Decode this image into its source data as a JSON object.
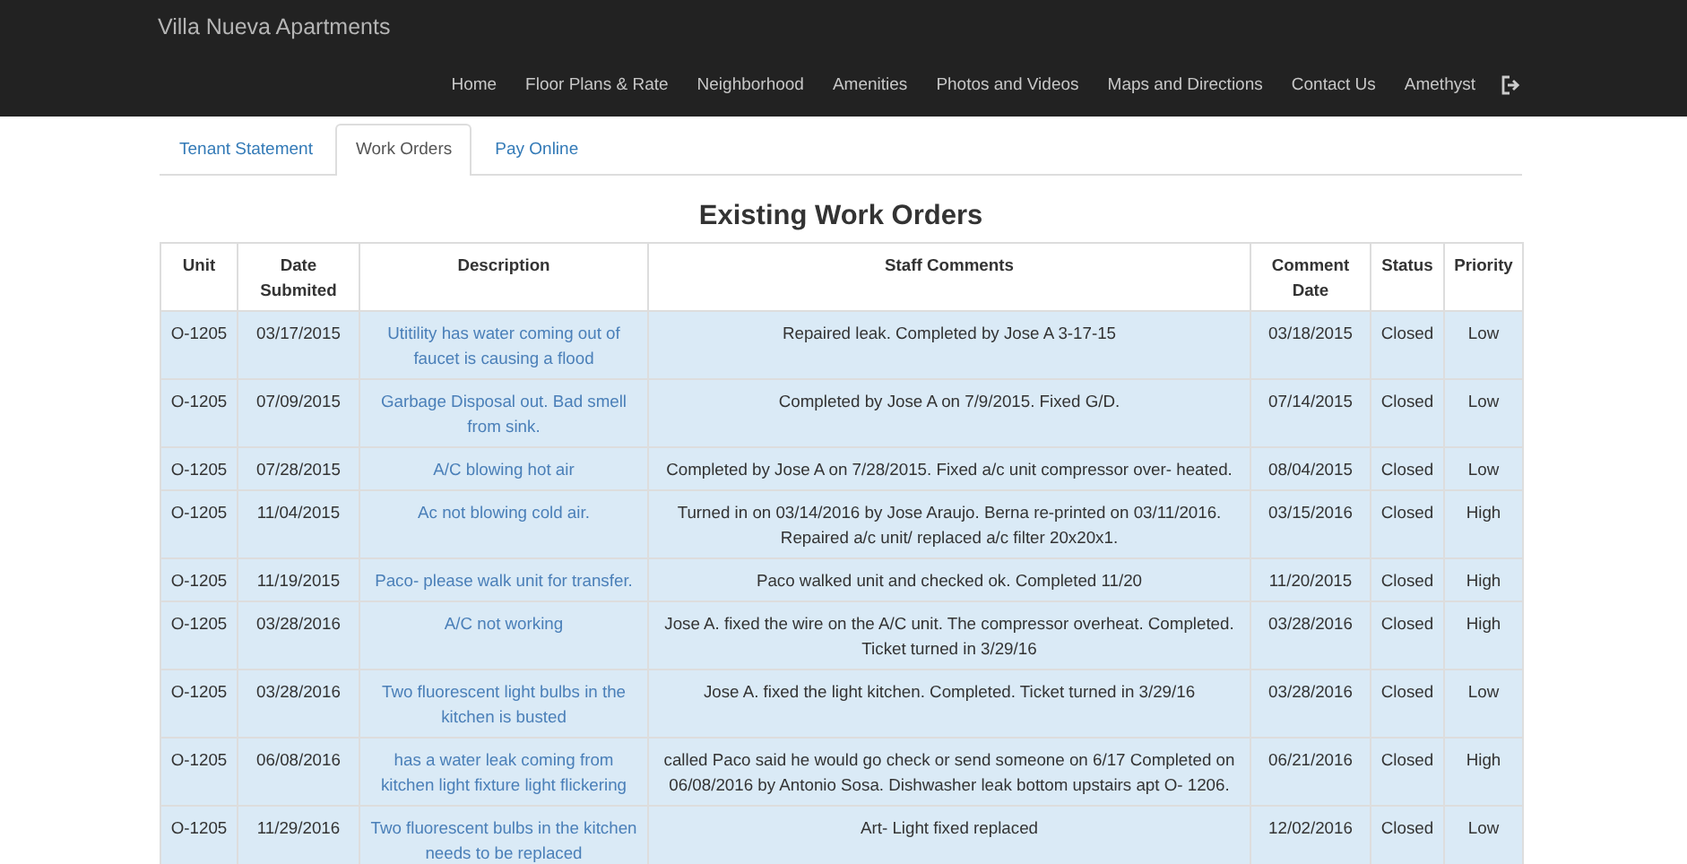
{
  "navbar": {
    "brand": "Villa Nueva Apartments",
    "links": [
      "Home",
      "Floor Plans & Rate",
      "Neighborhood",
      "Amenities",
      "Photos and Videos",
      "Maps and Directions",
      "Contact Us",
      "Amethyst"
    ]
  },
  "tabs": [
    {
      "label": "Tenant Statement",
      "selected": false
    },
    {
      "label": "Work Orders",
      "selected": true
    },
    {
      "label": "Pay Online",
      "selected": false
    }
  ],
  "heading": "Existing Work Orders",
  "table": {
    "columns": [
      "Unit",
      "Date Submited",
      "Description",
      "Staff Comments",
      "Comment Date",
      "Status",
      "Priority"
    ],
    "rows": [
      {
        "unit": "O-1205",
        "date": "03/17/2015",
        "description": "Utitility has water coming out of faucet is causing a flood",
        "comments": "Repaired leak. Completed by Jose A 3-17-15",
        "comment_date": "03/18/2015",
        "status": "Closed",
        "priority": "Low"
      },
      {
        "unit": "O-1205",
        "date": "07/09/2015",
        "description": "Garbage Disposal out. Bad smell from sink.",
        "comments": "Completed by Jose A on 7/9/2015. Fixed G/D.",
        "comment_date": "07/14/2015",
        "status": "Closed",
        "priority": "Low"
      },
      {
        "unit": "O-1205",
        "date": "07/28/2015",
        "description": "A/C blowing hot air",
        "comments": "Completed by Jose A on 7/28/2015. Fixed a/c unit compressor over- heated.",
        "comment_date": "08/04/2015",
        "status": "Closed",
        "priority": "Low"
      },
      {
        "unit": "O-1205",
        "date": "11/04/2015",
        "description": "Ac not blowing cold air.",
        "comments": "Turned in on 03/14/2016 by Jose Araujo. Berna re-printed on 03/11/2016. Repaired a/c unit/ replaced a/c filter 20x20x1.",
        "comment_date": "03/15/2016",
        "status": "Closed",
        "priority": "High"
      },
      {
        "unit": "O-1205",
        "date": "11/19/2015",
        "description": "Paco- please walk unit for transfer.",
        "comments": "Paco walked unit and checked ok. Completed 11/20",
        "comment_date": "11/20/2015",
        "status": "Closed",
        "priority": "High"
      },
      {
        "unit": "O-1205",
        "date": "03/28/2016",
        "description": "A/C not working",
        "comments": "Jose A. fixed the wire on the A/C unit. The compressor overheat. Completed. Ticket turned in 3/29/16",
        "comment_date": "03/28/2016",
        "status": "Closed",
        "priority": "High"
      },
      {
        "unit": "O-1205",
        "date": "03/28/2016",
        "description": "Two fluorescent light bulbs in the kitchen is busted",
        "comments": "Jose A. fixed the light kitchen. Completed. Ticket turned in 3/29/16",
        "comment_date": "03/28/2016",
        "status": "Closed",
        "priority": "Low"
      },
      {
        "unit": "O-1205",
        "date": "06/08/2016",
        "description": "has a water leak coming from kitchen light fixture light flickering",
        "comments": "called Paco said he would go check or send someone on 6/17 Completed on 06/08/2016 by Antonio Sosa. Dishwasher leak bottom upstairs apt O- 1206.",
        "comment_date": "06/21/2016",
        "status": "Closed",
        "priority": "High"
      },
      {
        "unit": "O-1205",
        "date": "11/29/2016",
        "description": "Two fluorescent bulbs in the kitchen needs to be replaced",
        "comments": "Art- Light fixed replaced",
        "comment_date": "12/02/2016",
        "status": "Closed",
        "priority": "Low"
      }
    ]
  }
}
